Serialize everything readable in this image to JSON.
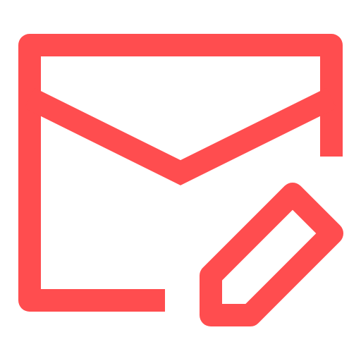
{
  "icon": {
    "name": "mail-edit-icon",
    "color": "#ff4d4f"
  }
}
